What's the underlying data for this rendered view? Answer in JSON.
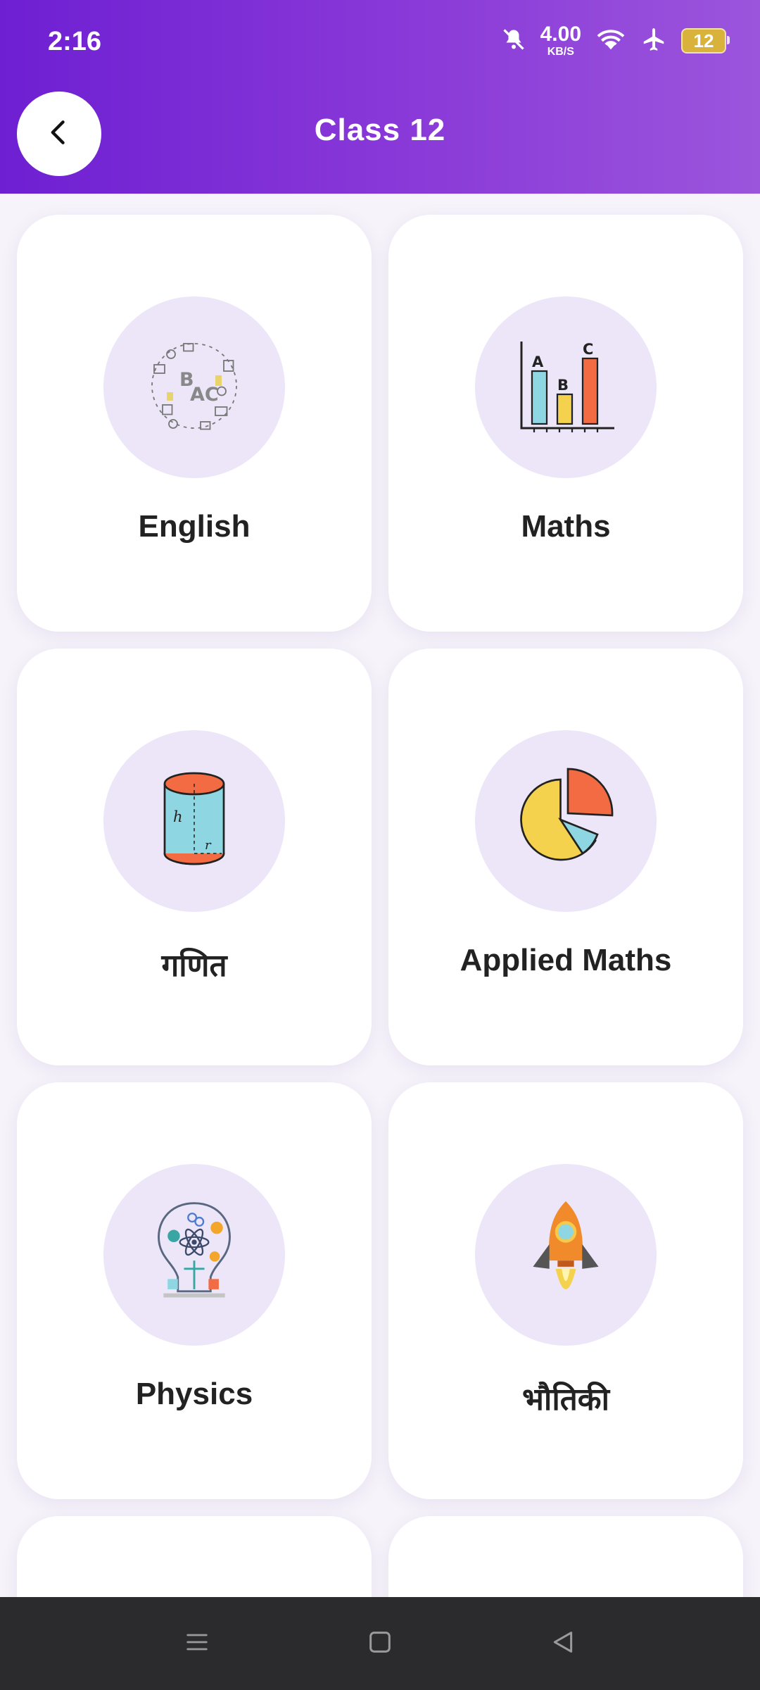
{
  "status_bar": {
    "time": "2:16",
    "net_speed_value": "4.00",
    "net_speed_unit": "KB/S",
    "battery": "12"
  },
  "header": {
    "title": "Class 12"
  },
  "subjects": [
    {
      "label": "English",
      "icon": "alphabet-doodle-icon"
    },
    {
      "label": "Maths",
      "icon": "bar-chart-abc-icon"
    },
    {
      "label": "गणित",
      "icon": "cylinder-icon"
    },
    {
      "label": "Applied Maths",
      "icon": "pie-chart-icon"
    },
    {
      "label": "Physics",
      "icon": "science-bulb-icon"
    },
    {
      "label": "भौतिकी",
      "icon": "rocket-icon"
    }
  ],
  "colors": {
    "header_start": "#6e1fd2",
    "header_end": "#9b55dc",
    "icon_circle": "#ece6f8",
    "nav_bg": "#2b2b2d"
  }
}
